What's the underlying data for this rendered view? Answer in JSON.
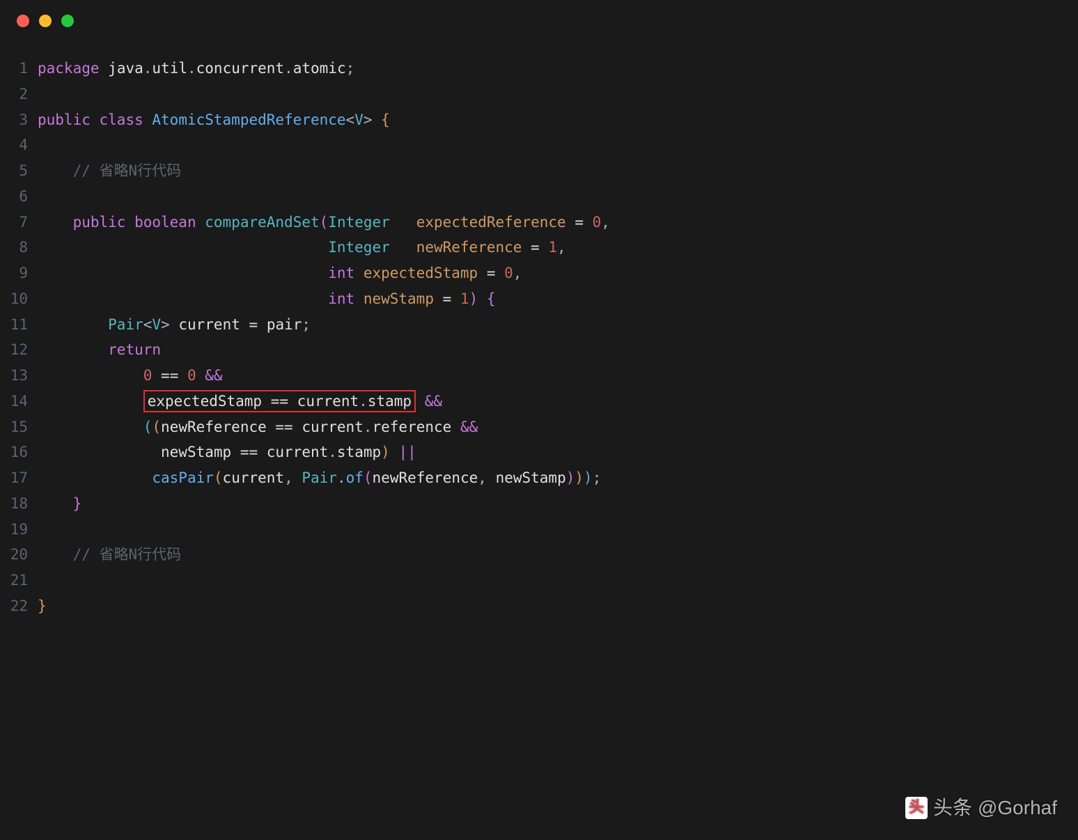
{
  "titlebar": {
    "buttons": [
      "close",
      "minimize",
      "zoom"
    ]
  },
  "watermark": {
    "prefix": "头条",
    "handle": "@Gorhaf"
  },
  "lines": [
    {
      "n": 1,
      "tokens": [
        {
          "c": "kw",
          "t": "package"
        },
        {
          "c": "op",
          "t": " "
        },
        {
          "c": "white",
          "t": "java"
        },
        {
          "c": "punct",
          "t": "."
        },
        {
          "c": "white",
          "t": "util"
        },
        {
          "c": "punct",
          "t": "."
        },
        {
          "c": "white",
          "t": "concurrent"
        },
        {
          "c": "punct",
          "t": "."
        },
        {
          "c": "white",
          "t": "atomic"
        },
        {
          "c": "punct",
          "t": ";"
        }
      ]
    },
    {
      "n": 2,
      "tokens": []
    },
    {
      "n": 3,
      "tokens": [
        {
          "c": "kw",
          "t": "public"
        },
        {
          "c": "op",
          "t": " "
        },
        {
          "c": "kw",
          "t": "class"
        },
        {
          "c": "op",
          "t": " "
        },
        {
          "c": "cls",
          "t": "AtomicStampedReference"
        },
        {
          "c": "punct",
          "t": "<"
        },
        {
          "c": "type",
          "t": "V"
        },
        {
          "c": "punct",
          "t": ">"
        },
        {
          "c": "op",
          "t": " "
        },
        {
          "c": "bracket1",
          "t": "{"
        }
      ]
    },
    {
      "n": 4,
      "tokens": []
    },
    {
      "n": 5,
      "tokens": [
        {
          "c": "op",
          "t": "    "
        },
        {
          "c": "comment",
          "t": "// 省略N行代码"
        }
      ]
    },
    {
      "n": 6,
      "tokens": []
    },
    {
      "n": 7,
      "tokens": [
        {
          "c": "op",
          "t": "    "
        },
        {
          "c": "kw",
          "t": "public"
        },
        {
          "c": "op",
          "t": " "
        },
        {
          "c": "kw",
          "t": "boolean"
        },
        {
          "c": "op",
          "t": " "
        },
        {
          "c": "fn2",
          "t": "compareAndSet"
        },
        {
          "c": "bracket2",
          "t": "("
        },
        {
          "c": "type",
          "t": "Integer"
        },
        {
          "c": "op",
          "t": "   "
        },
        {
          "c": "param",
          "t": "expectedReference"
        },
        {
          "c": "op",
          "t": " = "
        },
        {
          "c": "num",
          "t": "0"
        },
        {
          "c": "punct",
          "t": ","
        }
      ]
    },
    {
      "n": 8,
      "tokens": [
        {
          "c": "op",
          "t": "                                 "
        },
        {
          "c": "type",
          "t": "Integer"
        },
        {
          "c": "op",
          "t": "   "
        },
        {
          "c": "param",
          "t": "newReference"
        },
        {
          "c": "op",
          "t": " = "
        },
        {
          "c": "num",
          "t": "1"
        },
        {
          "c": "punct",
          "t": ","
        }
      ]
    },
    {
      "n": 9,
      "tokens": [
        {
          "c": "op",
          "t": "                                 "
        },
        {
          "c": "kw",
          "t": "int"
        },
        {
          "c": "op",
          "t": " "
        },
        {
          "c": "param",
          "t": "expectedStamp"
        },
        {
          "c": "op",
          "t": " = "
        },
        {
          "c": "num",
          "t": "0"
        },
        {
          "c": "punct",
          "t": ","
        }
      ]
    },
    {
      "n": 10,
      "tokens": [
        {
          "c": "op",
          "t": "                                 "
        },
        {
          "c": "kw",
          "t": "int"
        },
        {
          "c": "op",
          "t": " "
        },
        {
          "c": "param",
          "t": "newStamp"
        },
        {
          "c": "op",
          "t": " = "
        },
        {
          "c": "num",
          "t": "1"
        },
        {
          "c": "bracket2",
          "t": ")"
        },
        {
          "c": "op",
          "t": " "
        },
        {
          "c": "bracket2",
          "t": "{"
        }
      ]
    },
    {
      "n": 11,
      "tokens": [
        {
          "c": "op",
          "t": "        "
        },
        {
          "c": "type",
          "t": "Pair"
        },
        {
          "c": "punct",
          "t": "<"
        },
        {
          "c": "type",
          "t": "V"
        },
        {
          "c": "punct",
          "t": ">"
        },
        {
          "c": "op",
          "t": " "
        },
        {
          "c": "white",
          "t": "current"
        },
        {
          "c": "op",
          "t": " = "
        },
        {
          "c": "white",
          "t": "pair"
        },
        {
          "c": "punct",
          "t": ";"
        }
      ]
    },
    {
      "n": 12,
      "tokens": [
        {
          "c": "op",
          "t": "        "
        },
        {
          "c": "kw",
          "t": "return"
        }
      ]
    },
    {
      "n": 13,
      "tokens": [
        {
          "c": "op",
          "t": "            "
        },
        {
          "c": "num",
          "t": "0"
        },
        {
          "c": "op",
          "t": " == "
        },
        {
          "c": "num",
          "t": "0"
        },
        {
          "c": "op",
          "t": " "
        },
        {
          "c": "kw",
          "t": "&&"
        }
      ]
    },
    {
      "n": 14,
      "boxed": true,
      "boxTokens": [
        {
          "c": "white",
          "t": "expectedStamp"
        },
        {
          "c": "op",
          "t": " == "
        },
        {
          "c": "white",
          "t": "current"
        },
        {
          "c": "punct",
          "t": "."
        },
        {
          "c": "white",
          "t": "stamp"
        }
      ],
      "tokens": [
        {
          "c": "op",
          "t": " "
        },
        {
          "c": "kw",
          "t": "&&"
        }
      ],
      "indent": "            "
    },
    {
      "n": 15,
      "tokens": [
        {
          "c": "op",
          "t": "            "
        },
        {
          "c": "bracket3",
          "t": "("
        },
        {
          "c": "bracket1",
          "t": "("
        },
        {
          "c": "white",
          "t": "newReference"
        },
        {
          "c": "op",
          "t": " == "
        },
        {
          "c": "white",
          "t": "current"
        },
        {
          "c": "punct",
          "t": "."
        },
        {
          "c": "white",
          "t": "reference"
        },
        {
          "c": "op",
          "t": " "
        },
        {
          "c": "kw",
          "t": "&&"
        }
      ]
    },
    {
      "n": 16,
      "tokens": [
        {
          "c": "op",
          "t": "              "
        },
        {
          "c": "white",
          "t": "newStamp"
        },
        {
          "c": "op",
          "t": " == "
        },
        {
          "c": "white",
          "t": "current"
        },
        {
          "c": "punct",
          "t": "."
        },
        {
          "c": "white",
          "t": "stamp"
        },
        {
          "c": "bracket1",
          "t": ")"
        },
        {
          "c": "op",
          "t": " "
        },
        {
          "c": "kw",
          "t": "||"
        }
      ]
    },
    {
      "n": 17,
      "tokens": [
        {
          "c": "op",
          "t": "             "
        },
        {
          "c": "call",
          "t": "casPair"
        },
        {
          "c": "bracket1",
          "t": "("
        },
        {
          "c": "white",
          "t": "current"
        },
        {
          "c": "punct",
          "t": ", "
        },
        {
          "c": "type",
          "t": "Pair"
        },
        {
          "c": "punct",
          "t": "."
        },
        {
          "c": "call",
          "t": "of"
        },
        {
          "c": "bracket2",
          "t": "("
        },
        {
          "c": "white",
          "t": "newReference"
        },
        {
          "c": "punct",
          "t": ", "
        },
        {
          "c": "white",
          "t": "newStamp"
        },
        {
          "c": "bracket2",
          "t": ")"
        },
        {
          "c": "bracket1",
          "t": ")"
        },
        {
          "c": "bracket3",
          "t": ")"
        },
        {
          "c": "punct",
          "t": ";"
        }
      ]
    },
    {
      "n": 18,
      "tokens": [
        {
          "c": "op",
          "t": "    "
        },
        {
          "c": "bracket2",
          "t": "}"
        }
      ]
    },
    {
      "n": 19,
      "tokens": []
    },
    {
      "n": 20,
      "tokens": [
        {
          "c": "op",
          "t": "    "
        },
        {
          "c": "comment",
          "t": "// 省略N行代码"
        }
      ]
    },
    {
      "n": 21,
      "tokens": []
    },
    {
      "n": 22,
      "tokens": [
        {
          "c": "bracket1",
          "t": "}"
        }
      ]
    }
  ]
}
